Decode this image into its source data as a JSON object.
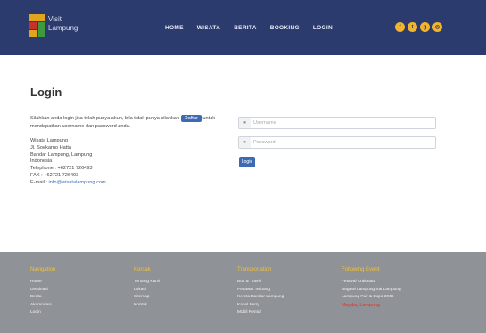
{
  "header": {
    "logo_line1": "Visit",
    "logo_line2": "Lampung",
    "nav": [
      "HOME",
      "WISATA",
      "BERITA",
      "BOOKING",
      "LOGIN"
    ],
    "social_icons": [
      "facebook-icon",
      "twitter-icon",
      "google-plus-icon",
      "instagram-icon"
    ],
    "colors": {
      "bar": "#2c3b6e",
      "accent": "#f0b52c"
    }
  },
  "main": {
    "title": "Login",
    "intro_before": "Silahkan anda login jika telah punya akun, bila tidak punya silahkan",
    "intro_button": "Daftar",
    "intro_after": "untuk mendapatkan username dan password anda.",
    "address": [
      "Wisata Lampung",
      "Jl. Soekarno Hatta",
      "Bandar Lampung, Lampung",
      "Indonesia",
      "Telephone : +62721 726493",
      "FAX : +62721 726493"
    ],
    "email_label": "E-mail : ",
    "email": "info@wisatalampung.com",
    "username_placeholder": "Username",
    "password_placeholder": "Password",
    "login_button": "Login"
  },
  "footer": {
    "columns": [
      {
        "title": "Navigation",
        "links": [
          "Home",
          "Destinasi",
          "Berita",
          "Akomodasi",
          "Login"
        ]
      },
      {
        "title": "Kontak",
        "links": [
          "Tentang Kami",
          "Lokasi",
          "Sitemap",
          "Kontak"
        ]
      },
      {
        "title": "Transportation",
        "links": [
          "Bus & Travel",
          "Pesawat Terbang",
          "Kereta Bandar Lampung",
          "Kapal Ferry",
          "Mobil Rental"
        ]
      },
      {
        "title": "Following Event",
        "links": [
          "Festival Krakatau",
          "Begawi Lampung Sai Lampung",
          "Lampung Fair & Expo 2016"
        ],
        "highlight": "Mayday Lampung"
      }
    ]
  }
}
